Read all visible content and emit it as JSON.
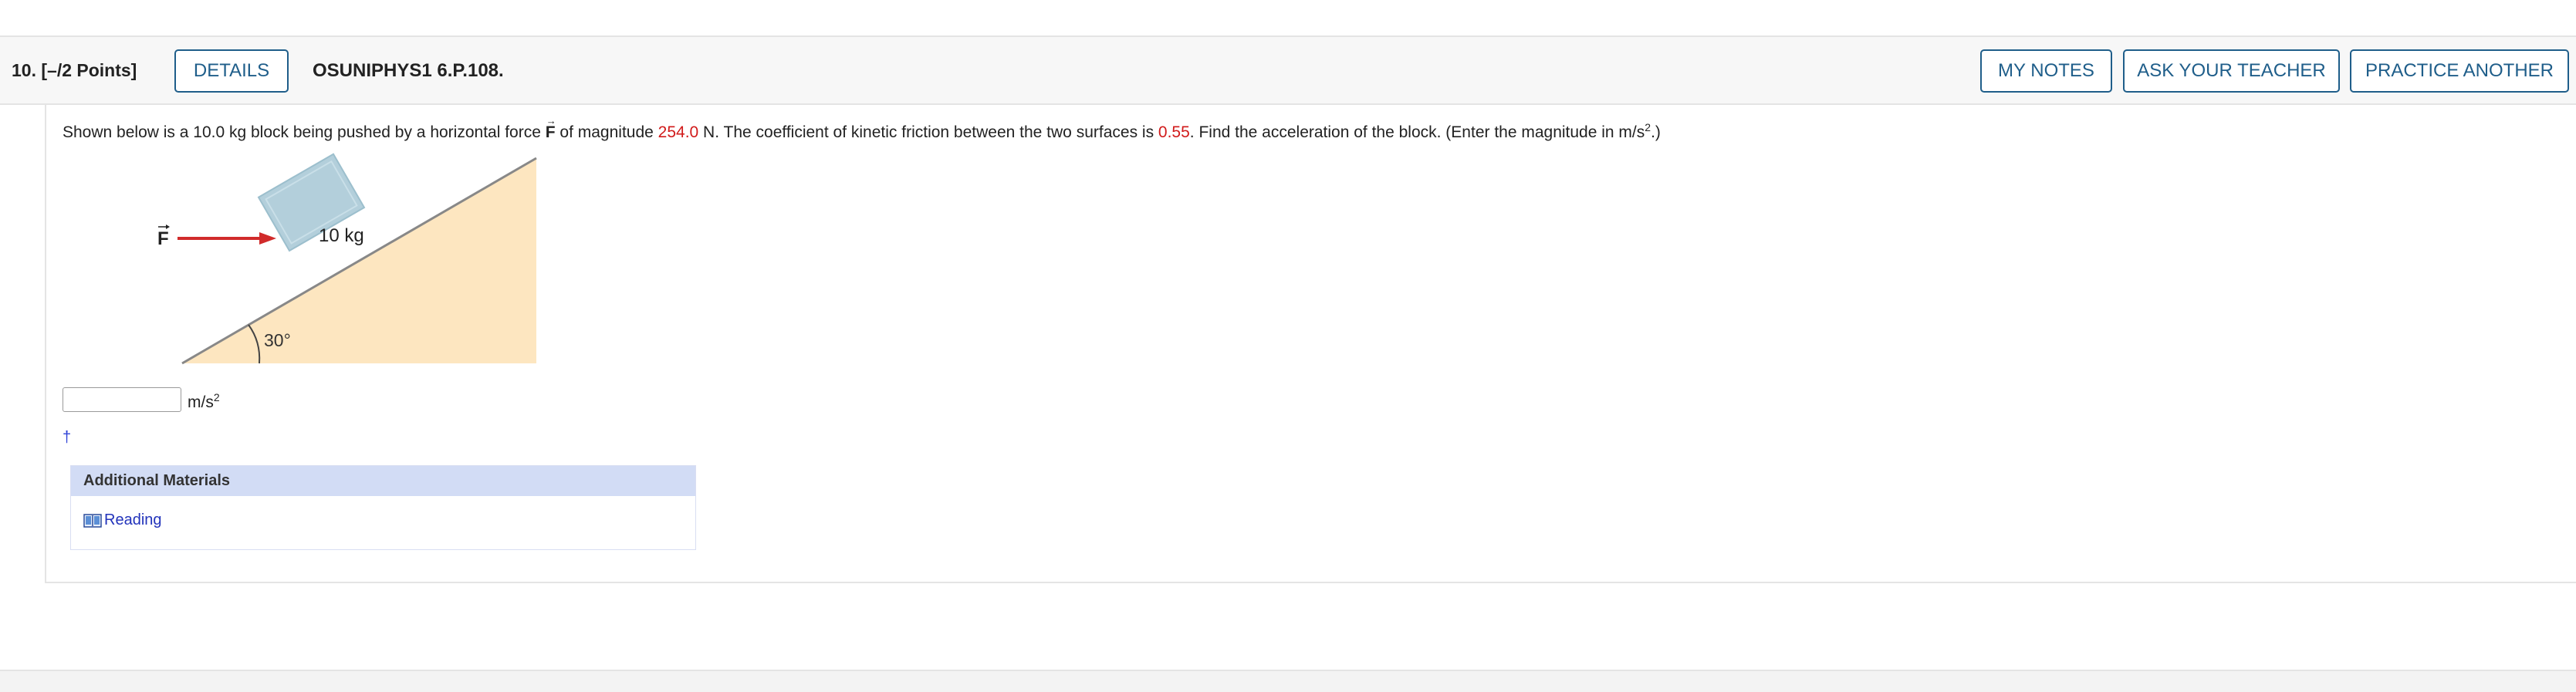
{
  "header": {
    "question_number": "10.",
    "points": "[–/2 Points]",
    "details_label": "DETAILS",
    "assignment_code": "OSUNIPHYS1 6.P.108.",
    "my_notes_label": "MY NOTES",
    "ask_teacher_label": "ASK YOUR TEACHER",
    "practice_label": "PRACTICE ANOTHER"
  },
  "question": {
    "text_1": "Shown below is a 10.0 kg block being pushed by a horizontal force ",
    "force_symbol": "F",
    "text_2": " of magnitude ",
    "force_value": "254.0",
    "text_3": " N. The coefficient of kinetic friction between the two surfaces is ",
    "friction_value": "0.55",
    "text_4": ". Find the acceleration of the block. (Enter the magnitude in m/s",
    "text_exponent": "2",
    "text_5": ".)"
  },
  "figure": {
    "force_label": "F",
    "block_label": "10 kg",
    "angle_label": "30°",
    "colors": {
      "incline": "#fde6c0",
      "block": "#b3cfdb",
      "arrow": "#d12b2b"
    }
  },
  "answer": {
    "value": "",
    "unit": "m/s",
    "unit_exponent": "2"
  },
  "dagger": "†",
  "additional_materials": {
    "title": "Additional Materials",
    "reading_label": "Reading",
    "reading_icon": "book-icon"
  }
}
